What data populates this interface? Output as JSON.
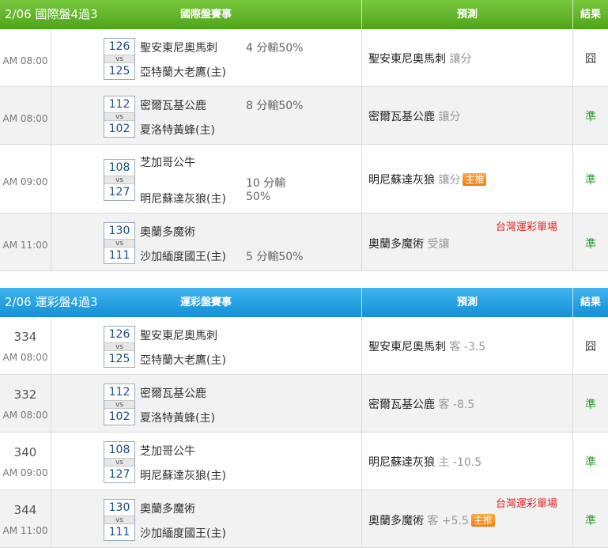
{
  "section1": {
    "title": "2/06 國際盤4過3",
    "col_match": "國際盤賽事",
    "col_pred": "預測",
    "col_result": "結果",
    "rows": [
      {
        "time": "AM 08:00",
        "away_no": "126",
        "vs": "vs",
        "home_no": "125",
        "away": "聖安東尼奧馬刺",
        "home": "亞特蘭大老鷹(主)",
        "odds": "4 分輸50%",
        "pick": "聖安東尼奧馬刺",
        "pick_tag": "讓分",
        "result": "囧"
      },
      {
        "time": "AM 08:00",
        "away_no": "112",
        "vs": "vs",
        "home_no": "102",
        "away": "密爾瓦基公鹿",
        "home": "夏洛特黃蜂(主)",
        "odds": "8 分輸50%",
        "pick": "密爾瓦基公鹿",
        "pick_tag": "讓分",
        "result": "準"
      },
      {
        "time": "AM 09:00",
        "away_no": "108",
        "vs": "vs",
        "home_no": "127",
        "away": "芝加哥公牛",
        "home": "明尼蘇達灰狼(主)",
        "odds_line1": "10 分輸",
        "odds_line2": "50%",
        "pick": "明尼蘇達灰狼",
        "pick_tag": "讓分",
        "badge": "主推",
        "result": "準"
      },
      {
        "time": "AM 11:00",
        "away_no": "130",
        "vs": "vs",
        "home_no": "111",
        "away": "奧蘭多魔術",
        "home": "沙加緬度國王(主)",
        "odds": "5 分輸50%",
        "pick": "奧蘭多魔術",
        "pick_tag": "受讓",
        "note": "台灣運彩單場",
        "result": "準"
      }
    ]
  },
  "section2": {
    "title": "2/06 運彩盤4過3",
    "col_match": "運彩盤賽事",
    "col_pred": "預測",
    "col_result": "結果",
    "rows": [
      {
        "num": "334",
        "time": "AM 08:00",
        "away_no": "126",
        "vs": "vs",
        "home_no": "125",
        "away": "聖安東尼奧馬刺",
        "home": "亞特蘭大老鷹(主)",
        "pick": "聖安東尼奧馬刺",
        "pick_tag": "客 -3.5",
        "result": "囧"
      },
      {
        "num": "332",
        "time": "AM 08:00",
        "away_no": "112",
        "vs": "vs",
        "home_no": "102",
        "away": "密爾瓦基公鹿",
        "home": "夏洛特黃蜂(主)",
        "pick": "密爾瓦基公鹿",
        "pick_tag": "客 -8.5",
        "result": "準"
      },
      {
        "num": "340",
        "time": "AM 09:00",
        "away_no": "108",
        "vs": "vs",
        "home_no": "127",
        "away": "芝加哥公牛",
        "home": "明尼蘇達灰狼(主)",
        "pick": "明尼蘇達灰狼",
        "pick_tag": "主 -10.5",
        "result": "準"
      },
      {
        "num": "344",
        "time": "AM 11:00",
        "away_no": "130",
        "vs": "vs",
        "home_no": "111",
        "away": "奧蘭多魔術",
        "home": "沙加緬度國王(主)",
        "pick": "奧蘭多魔術",
        "pick_tag": "客 +5.5",
        "badge": "主推",
        "note": "台灣運彩單場",
        "result": "準"
      }
    ]
  },
  "colors": {
    "green_header": "#5cb02a",
    "blue_header": "#1d9ce0",
    "hit": "#2a9a2a",
    "note": "#e02020",
    "badge": "#f08a1c"
  }
}
